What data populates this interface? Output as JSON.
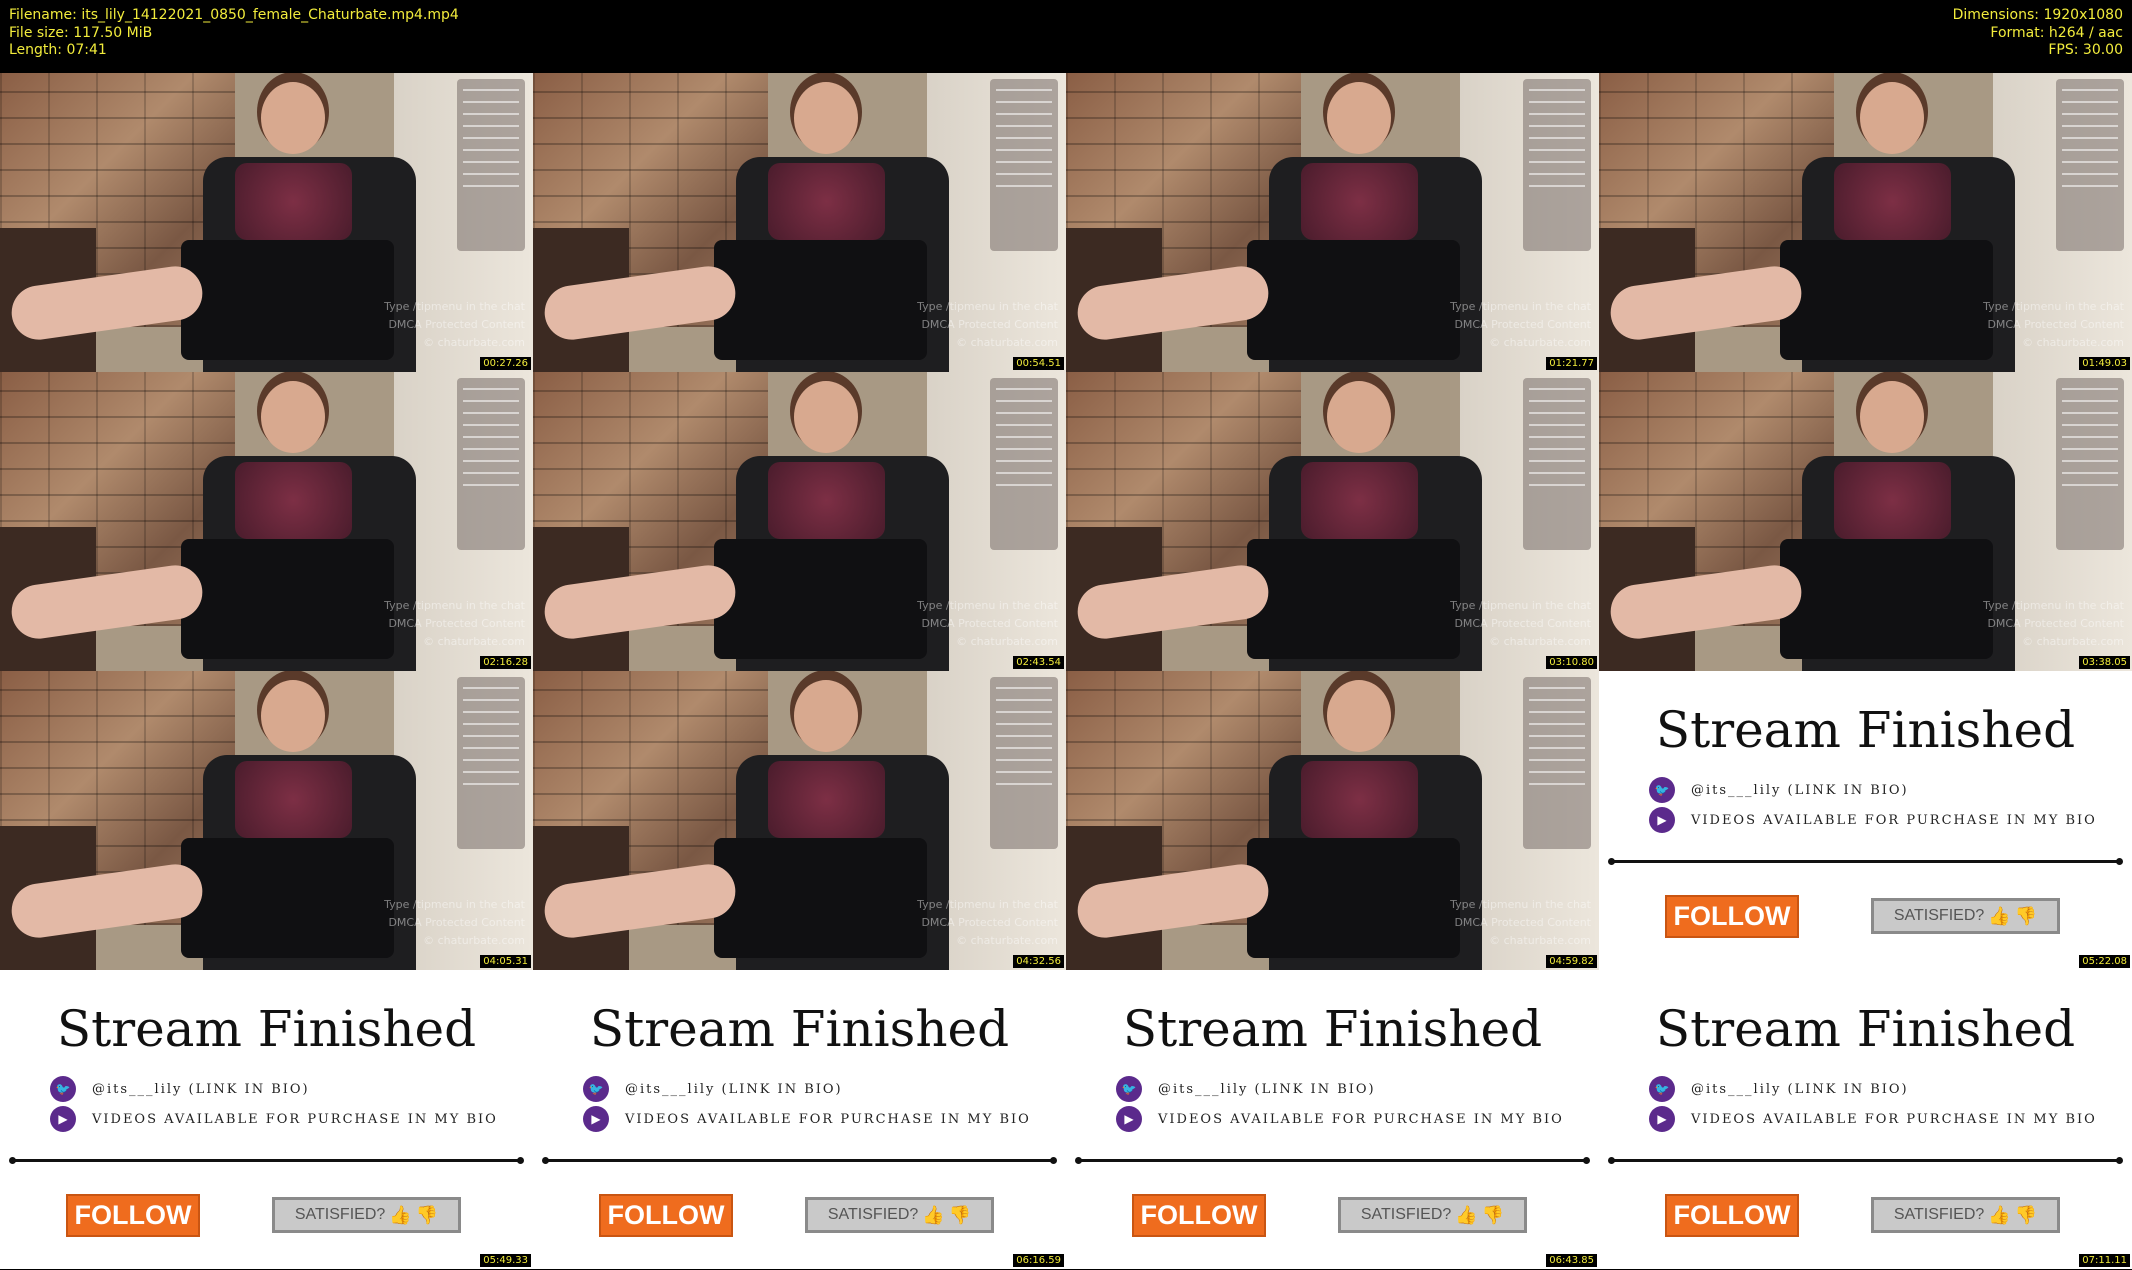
{
  "header": {
    "filename_label": "Filename:",
    "filename": "its_lily_14122021_0850_female_Chaturbate.mp4.mp4",
    "filesize_label": "File size:",
    "filesize": "117.50 MiB",
    "length_label": "Length:",
    "length": "07:41",
    "dimensions_label": "Dimensions:",
    "dimensions": "1920x1080",
    "format_label": "Format:",
    "format": "h264 / aac",
    "fps_label": "FPS:",
    "fps": "30.00"
  },
  "thumbs": [
    {
      "kind": "video",
      "timestamp": "00:27.26"
    },
    {
      "kind": "video",
      "timestamp": "00:54.51"
    },
    {
      "kind": "video",
      "timestamp": "01:21.77"
    },
    {
      "kind": "video",
      "timestamp": "01:49.03"
    },
    {
      "kind": "video",
      "timestamp": "02:16.28"
    },
    {
      "kind": "video",
      "timestamp": "02:43.54"
    },
    {
      "kind": "video",
      "timestamp": "03:10.80"
    },
    {
      "kind": "video",
      "timestamp": "03:38.05"
    },
    {
      "kind": "video",
      "timestamp": "04:05.31"
    },
    {
      "kind": "video",
      "timestamp": "04:32.56"
    },
    {
      "kind": "video",
      "timestamp": "04:59.82"
    },
    {
      "kind": "finished",
      "timestamp": "05:22.08"
    },
    {
      "kind": "finished",
      "timestamp": "05:49.33"
    },
    {
      "kind": "finished",
      "timestamp": "06:16.59"
    },
    {
      "kind": "finished",
      "timestamp": "06:43.85"
    },
    {
      "kind": "finished",
      "timestamp": "07:11.11"
    }
  ],
  "watermark": {
    "line1": "Type /tipmenu in the chat",
    "line2": "DMCA Protected Content",
    "line3": "© chaturbate.com"
  },
  "finished_card": {
    "title": "Stream Finished",
    "twitter_handle": "@its___lily (LINK IN BIO)",
    "videos_text": "VIDEOS AVAILABLE FOR PURCHASE IN MY BIO",
    "follow_label": "FOLLOW",
    "satisfied_label": "SATISFIED?",
    "icons": [
      "twitter-icon",
      "play-icon",
      "thumbs-up-icon",
      "thumbs-down-icon"
    ]
  },
  "colors": {
    "header_text": "#f2ec3c",
    "follow_bg": "#ef6c1e",
    "icon_circle": "#5b2a8c"
  }
}
